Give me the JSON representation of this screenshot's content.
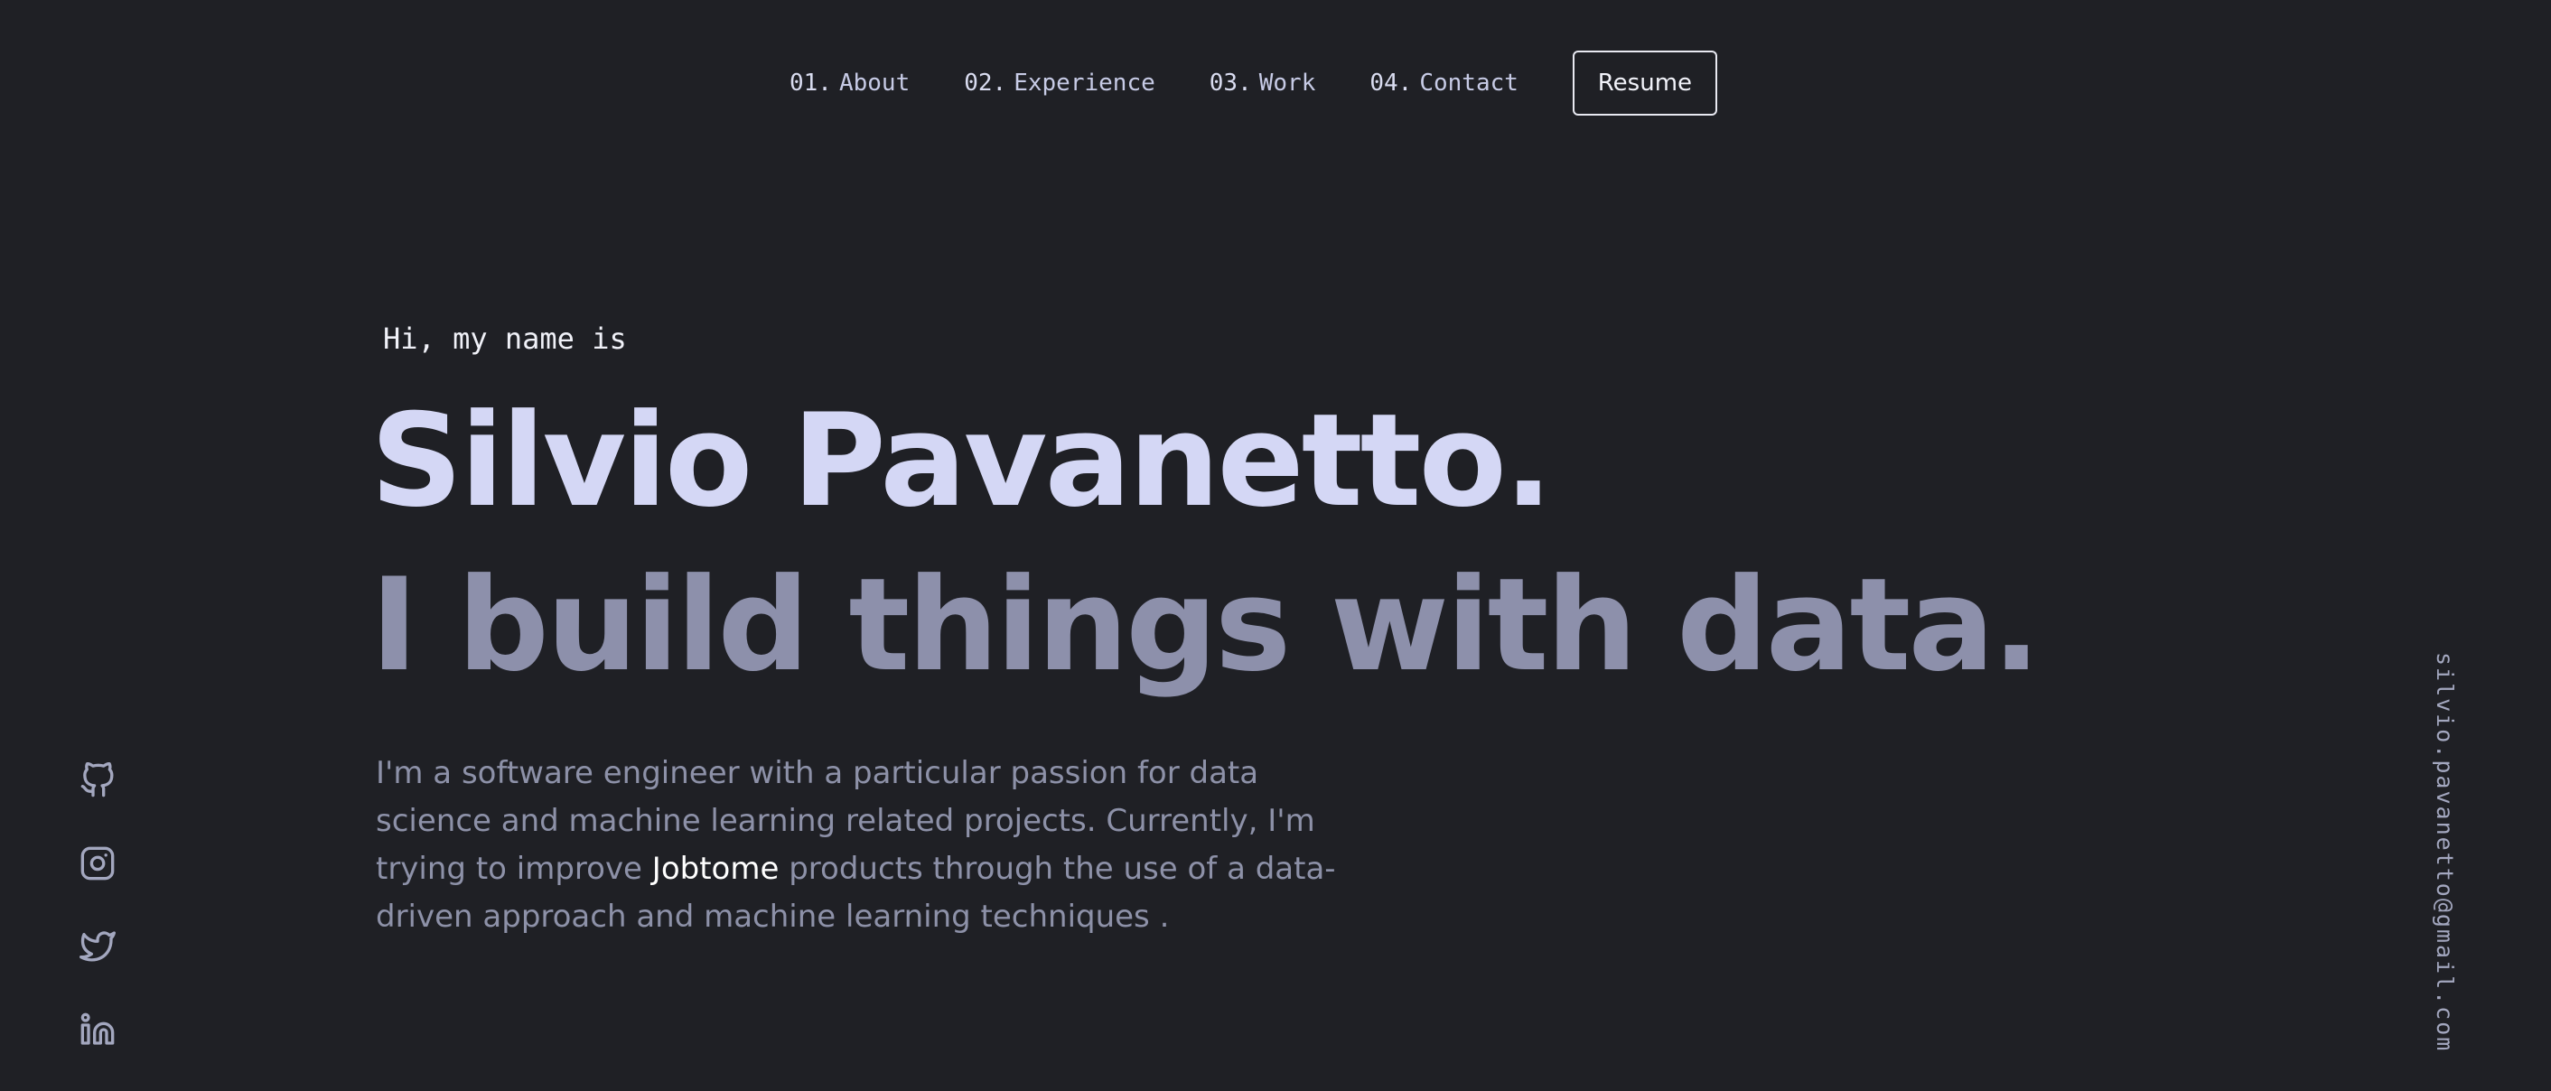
{
  "nav": {
    "items": [
      {
        "num": "01.",
        "label": "About"
      },
      {
        "num": "02.",
        "label": "Experience"
      },
      {
        "num": "03.",
        "label": "Work"
      },
      {
        "num": "04.",
        "label": "Contact"
      }
    ],
    "resume_label": "Resume"
  },
  "hero": {
    "greeting": "Hi, my name is",
    "name": "Silvio Pavanetto.",
    "tagline": "I build things with data.",
    "bio_part1": "I'm a software engineer with a particular passion for data science and machine learning related projects. Currently, I'm trying to improve ",
    "bio_link": "Jobtome",
    "bio_part2": " products through the use of a data-driven approach and machine learning techniques ."
  },
  "socials": [
    {
      "icon": "github-icon"
    },
    {
      "icon": "instagram-icon"
    },
    {
      "icon": "twitter-icon"
    },
    {
      "icon": "linkedin-icon"
    }
  ],
  "email": "silvio.pavanetto@gmail.com",
  "colors": {
    "background": "#1f2025",
    "name": "#d4d7f5",
    "tagline": "#8d90ab",
    "body_text": "#8d91a8",
    "highlight": "#ffffff"
  }
}
